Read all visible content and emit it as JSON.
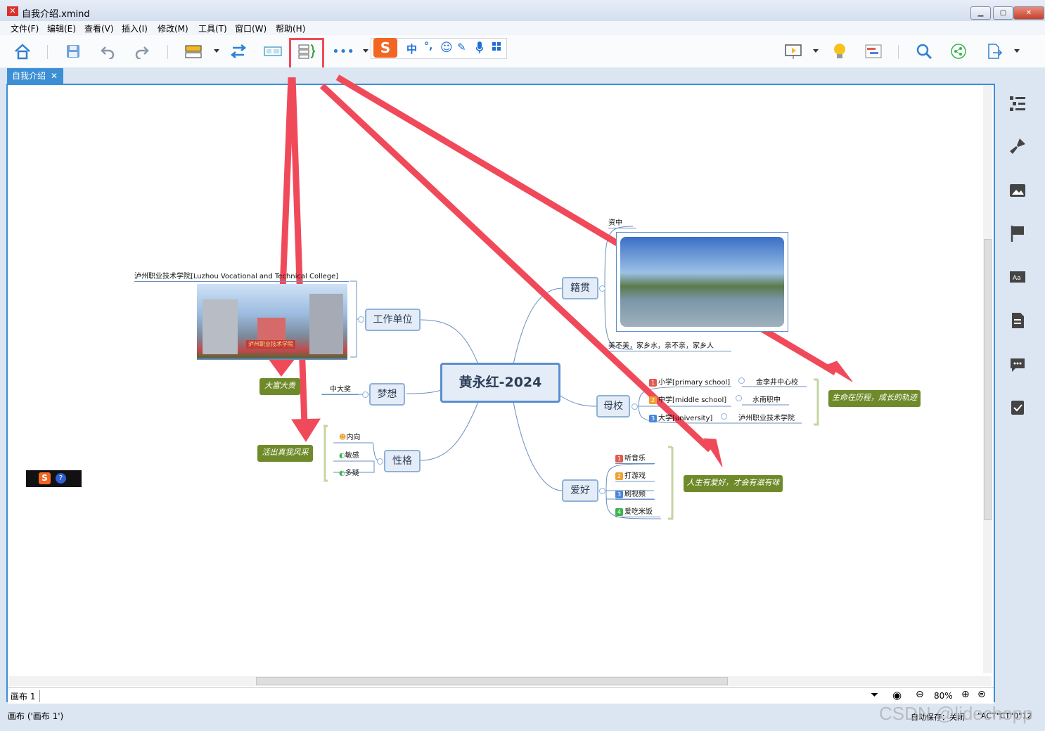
{
  "window": {
    "title": "自我介绍.xmind",
    "logo": "✕",
    "controls": [
      "minimize",
      "maximize",
      "close"
    ]
  },
  "menu": [
    "文件(F)",
    "编辑(E)",
    "查看(V)",
    "插入(I)",
    "修改(M)",
    "工具(T)",
    "窗口(W)",
    "帮助(H)"
  ],
  "toolbar": {
    "icons": [
      "home-icon",
      "save-icon",
      "undo-icon",
      "redo-icon",
      "topic-icon",
      "relationship-icon",
      "boundary-icon",
      "summary-icon",
      "more-icon",
      "presentation-icon",
      "idea-icon",
      "gantt-icon",
      "search-icon",
      "share-icon",
      "export-icon"
    ],
    "highlighted": "summary-icon"
  },
  "ime": {
    "logo": "S",
    "mode": "中",
    "punct": "°,"
  },
  "tab": {
    "label": "自我介绍",
    "close": "✕"
  },
  "mindmap": {
    "central": "黄永红-2024",
    "branches": {
      "work": {
        "label": "工作单位",
        "item": "泸州职业技术学院[Luzhou Vocational and Technical College]",
        "image_caption": "泸州职业技术学院"
      },
      "dream": {
        "label": "梦想",
        "item": "中大奖",
        "summary": "大富大贵"
      },
      "personality": {
        "label": "性格",
        "items": [
          "内向",
          "敏感",
          "多疑"
        ],
        "summary": "活出真我风采"
      },
      "hometown": {
        "label": "籍贯",
        "item": "资中",
        "caption": "美不美，家乡水，亲不亲，家乡人"
      },
      "school": {
        "label": "母校",
        "items": [
          {
            "n": "1",
            "level": "小学[primary school]",
            "name": "金李井中心校"
          },
          {
            "n": "2",
            "level": "中学[middle school]",
            "name": "水南职中"
          },
          {
            "n": "3",
            "level": "大学[university]",
            "name": "泸州职业技术学院"
          }
        ],
        "summary": "生命在历程，成长的轨迹"
      },
      "hobby": {
        "label": "爱好",
        "items": [
          {
            "n": "1",
            "text": "听音乐",
            "color": "#e05a4f"
          },
          {
            "n": "2",
            "text": "打游戏",
            "color": "#f0a030"
          },
          {
            "n": "3",
            "text": "刷视频",
            "color": "#4a86d8"
          },
          {
            "n": "4",
            "text": "爱吃米饭",
            "color": "#3fb34f"
          }
        ],
        "summary": "人生有爱好，才会有滋有味"
      }
    }
  },
  "floating": {
    "s": "S",
    "q": "?"
  },
  "sheet": {
    "tab": "画布 1",
    "zoom": "80%"
  },
  "status": {
    "left": "画布 ('画布 1')",
    "autosave": "自动保存：关闭",
    "user": "\"ACT\"CT\"0\"12",
    "watermark": "CSDN @lidechopp"
  },
  "colors": {
    "accent": "#3c8fd4",
    "arrow": "#f04a5a",
    "summary": "#6f8a2a",
    "node_border": "#8eb1d8"
  }
}
